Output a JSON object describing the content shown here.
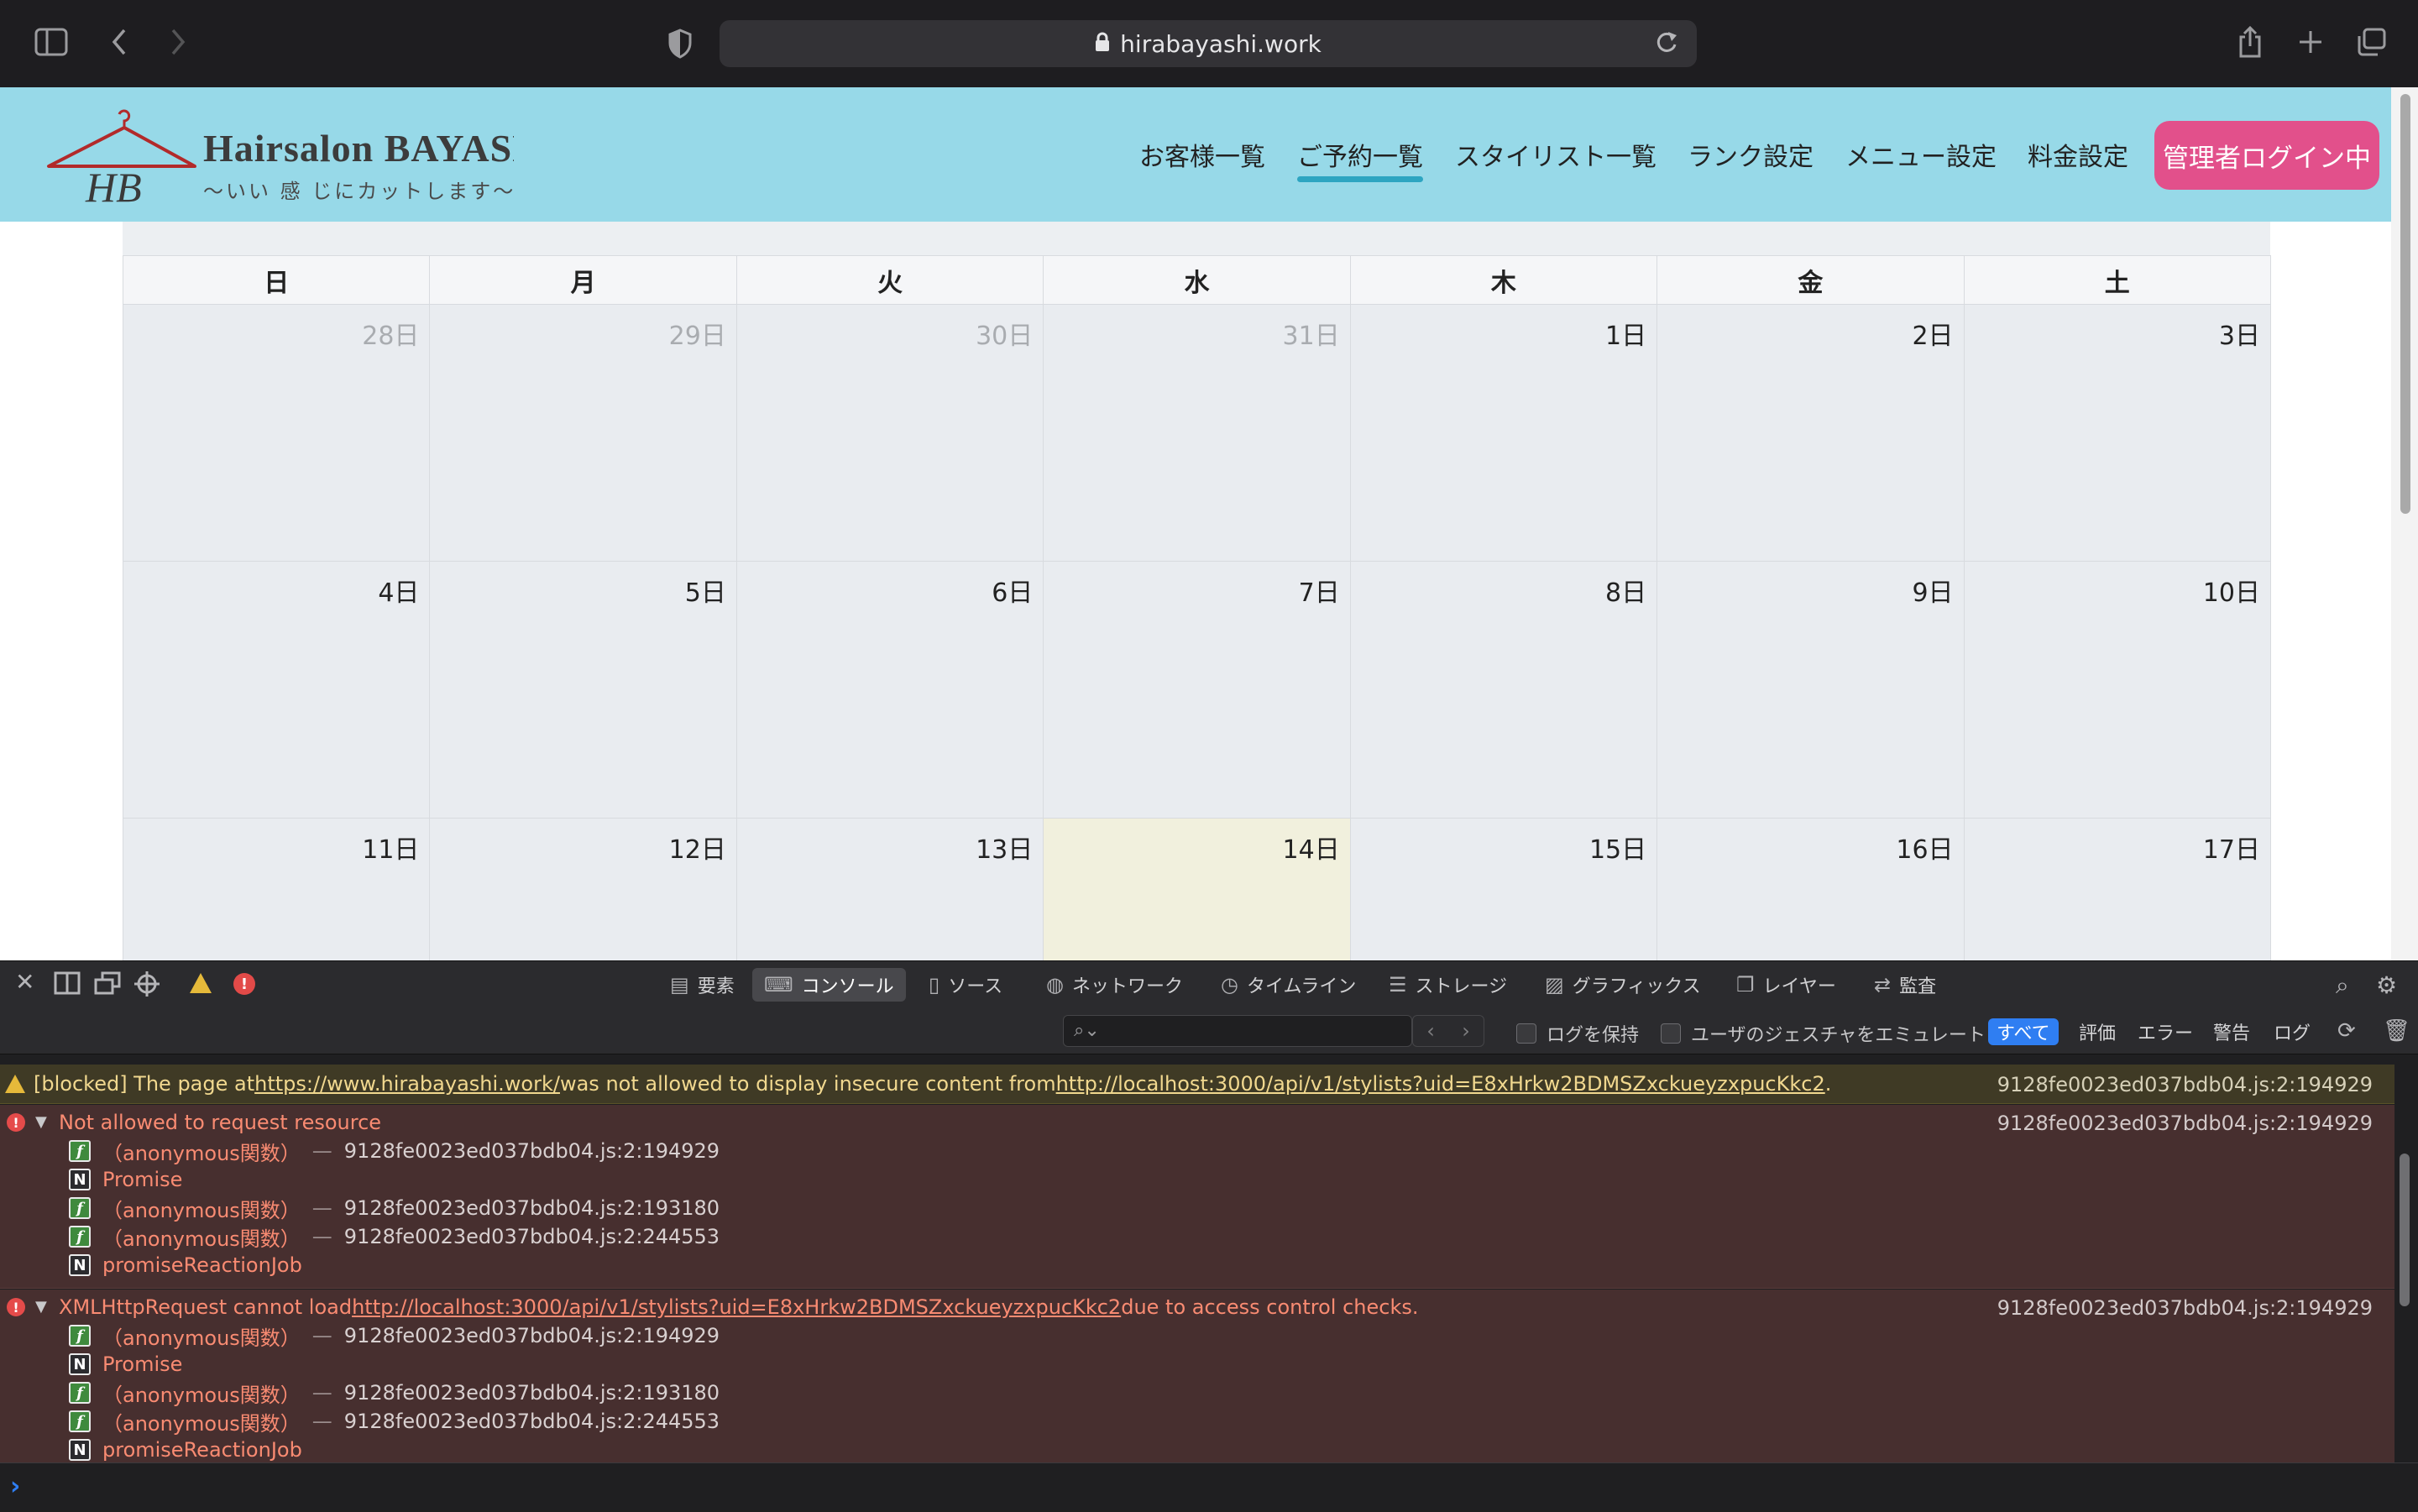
{
  "browser": {
    "url": "hirabayashi.work"
  },
  "site": {
    "brand_name": "Hairsalon BAYASHI",
    "brand_tagline": "〜いい 感 じにカットします〜",
    "logo_mark": "HB",
    "nav": [
      "お客様一覧",
      "ご予約一覧",
      "スタイリスト一覧",
      "ランク設定",
      "メニュー設定",
      "料金設定"
    ],
    "active_nav": "ご予約一覧",
    "login_button": "管理者ログイン中",
    "accent_color": "#97d9e8",
    "login_color": "#e2508b"
  },
  "calendar": {
    "weekdays": [
      "日",
      "月",
      "火",
      "水",
      "木",
      "金",
      "土"
    ],
    "weeks": [
      [
        {
          "d": "28日",
          "other": true
        },
        {
          "d": "29日",
          "other": true
        },
        {
          "d": "30日",
          "other": true
        },
        {
          "d": "31日",
          "other": true
        },
        {
          "d": "1日"
        },
        {
          "d": "2日"
        },
        {
          "d": "3日"
        }
      ],
      [
        {
          "d": "4日"
        },
        {
          "d": "5日"
        },
        {
          "d": "6日"
        },
        {
          "d": "7日"
        },
        {
          "d": "8日"
        },
        {
          "d": "9日"
        },
        {
          "d": "10日"
        }
      ],
      [
        {
          "d": "11日"
        },
        {
          "d": "12日"
        },
        {
          "d": "13日"
        },
        {
          "d": "14日",
          "today": true
        },
        {
          "d": "15日"
        },
        {
          "d": "16日"
        },
        {
          "d": "17日"
        }
      ]
    ]
  },
  "inspector": {
    "tabs": [
      {
        "label": "要素",
        "icon": "elements-icon"
      },
      {
        "label": "コンソール",
        "icon": "console-icon",
        "active": true
      },
      {
        "label": "ソース",
        "icon": "sources-icon"
      },
      {
        "label": "ネットワーク",
        "icon": "network-icon"
      },
      {
        "label": "タイムライン",
        "icon": "timeline-icon"
      },
      {
        "label": "ストレージ",
        "icon": "storage-icon"
      },
      {
        "label": "グラフィックス",
        "icon": "graphics-icon"
      },
      {
        "label": "レイヤー",
        "icon": "layers-icon"
      },
      {
        "label": "監査",
        "icon": "audit-icon"
      }
    ],
    "filter_placeholder": "",
    "preserve_log": "ログを保持",
    "emulate_gesture": "ユーザのジェスチャをエミュレート",
    "levels": [
      "すべて",
      "評価",
      "エラー",
      "警告",
      "ログ"
    ],
    "active_level": "すべて",
    "warning": {
      "prefix": "[blocked] The page at ",
      "page_url": "https://www.hirabayashi.work/",
      "middle": " was not allowed to display insecure content from ",
      "content_url": "http://localhost:3000/api/v1/stylists?uid=E8xHrkw2BDMSZxckueyzxpucKkc2",
      "suffix": ".",
      "location": "9128fe0023ed037bdb04.js:2:194929"
    },
    "errors": [
      {
        "title_prefix": "Not allowed to request resource",
        "title_url": "",
        "title_suffix": "",
        "location": "9128fe0023ed037bdb04.js:2:194929",
        "frames": [
          {
            "type": "f",
            "name": "（anonymous関数）",
            "loc": "9128fe0023ed037bdb04.js:2:194929"
          },
          {
            "type": "N",
            "name": "Promise",
            "loc": ""
          },
          {
            "type": "f",
            "name": "（anonymous関数）",
            "loc": "9128fe0023ed037bdb04.js:2:193180"
          },
          {
            "type": "f",
            "name": "（anonymous関数）",
            "loc": "9128fe0023ed037bdb04.js:2:244553"
          },
          {
            "type": "N",
            "name": "promiseReactionJob",
            "loc": ""
          }
        ]
      },
      {
        "title_prefix": "XMLHttpRequest cannot load ",
        "title_url": "http://localhost:3000/api/v1/stylists?uid=E8xHrkw2BDMSZxckueyzxpucKkc2",
        "title_suffix": " due to access control checks.",
        "location": "9128fe0023ed037bdb04.js:2:194929",
        "frames": [
          {
            "type": "f",
            "name": "（anonymous関数）",
            "loc": "9128fe0023ed037bdb04.js:2:194929"
          },
          {
            "type": "N",
            "name": "Promise",
            "loc": ""
          },
          {
            "type": "f",
            "name": "（anonymous関数）",
            "loc": "9128fe0023ed037bdb04.js:2:193180"
          },
          {
            "type": "f",
            "name": "（anonymous関数）",
            "loc": "9128fe0023ed037bdb04.js:2:244553"
          },
          {
            "type": "N",
            "name": "promiseReactionJob",
            "loc": ""
          }
        ]
      }
    ]
  }
}
